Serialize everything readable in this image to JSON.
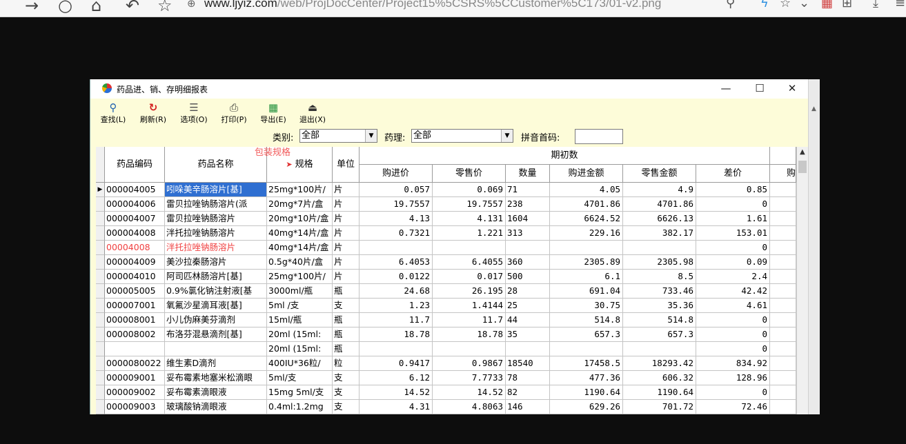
{
  "browser": {
    "url_host": "www.ljyiz.com",
    "url_path": "/web/ProjDocCenter/Project15%5CSRS%5CCustomer%5C173/01-v2.png"
  },
  "window": {
    "title": "药品进、销、存明细报表",
    "minimize": "—",
    "maximize": "☐",
    "close": "✕"
  },
  "toolbar": {
    "buttons": [
      {
        "label": "查找(L)",
        "icon": "search-icon",
        "glyph": "🔍"
      },
      {
        "label": "刷新(R)",
        "icon": "refresh-icon",
        "glyph": "↻"
      },
      {
        "label": "选项(O)",
        "icon": "options-icon",
        "glyph": "☰"
      },
      {
        "label": "打印(P)",
        "icon": "printer-icon",
        "glyph": "⎙"
      },
      {
        "label": "导出(E)",
        "icon": "excel-export-icon",
        "glyph": "▦"
      },
      {
        "label": "退出(X)",
        "icon": "exit-door-icon",
        "glyph": "⏏"
      }
    ]
  },
  "filters": {
    "category_label": "类别:",
    "category_value": "全部",
    "pharmacology_label": "药理:",
    "pharmacology_value": "全部",
    "pinyin_label": "拼音首码:",
    "pinyin_value": ""
  },
  "overlay_label": "包装规格",
  "grid": {
    "headers": {
      "code": "药品编码",
      "name": "药品名称",
      "spec": "规格",
      "unit": "单位",
      "group": "期初数",
      "purchase_price": "购进价",
      "retail_price": "零售价",
      "qty": "数量",
      "purchase_amount": "购进金额",
      "retail_amount": "零售金额",
      "diff": "差价",
      "next": "购"
    },
    "rows": [
      {
        "code": "000004005",
        "name": "吲哚美辛肠溶片[基]",
        "spec": "25mg*100片/",
        "unit": "片",
        "pp": "0.057",
        "rp": "0.069",
        "qty": "71",
        "pa": "4.05",
        "ra": "4.9",
        "diff": "0.85"
      },
      {
        "code": "000004006",
        "name": "雷贝拉唑钠肠溶片(派",
        "spec": "20mg*7片/盒",
        "unit": "片",
        "pp": "19.7557",
        "rp": "19.7557",
        "qty": "238",
        "pa": "4701.86",
        "ra": "4701.86",
        "diff": "0"
      },
      {
        "code": "000004007",
        "name": "雷贝拉唑钠肠溶片",
        "spec": "20mg*10片/盒",
        "unit": "片",
        "pp": "4.13",
        "rp": "4.131",
        "qty": "1604",
        "pa": "6624.52",
        "ra": "6626.13",
        "diff": "1.61"
      },
      {
        "code": "000004008",
        "name": "泮托拉唑钠肠溶片",
        "spec": "40mg*14片/盒",
        "unit": "片",
        "pp": "0.7321",
        "rp": "1.221",
        "qty": "313",
        "pa": "229.16",
        "ra": "382.17",
        "diff": "153.01"
      },
      {
        "code": "00004008",
        "name": "泮托拉唑钠肠溶片",
        "spec": "40mg*14片/盒",
        "unit": "片",
        "pp": "",
        "rp": "",
        "qty": "",
        "pa": "",
        "ra": "",
        "diff": "0",
        "red": true
      },
      {
        "code": "000004009",
        "name": "美沙拉秦肠溶片",
        "spec": "0.5g*40片/盒",
        "unit": "片",
        "pp": "6.4053",
        "rp": "6.4055",
        "qty": "360",
        "pa": "2305.89",
        "ra": "2305.98",
        "diff": "0.09"
      },
      {
        "code": "000004010",
        "name": "阿司匹林肠溶片[基]",
        "spec": "25mg*100片/",
        "unit": "片",
        "pp": "0.0122",
        "rp": "0.017",
        "qty": "500",
        "pa": "6.1",
        "ra": "8.5",
        "diff": "2.4"
      },
      {
        "code": "000005005",
        "name": "0.9%氯化钠注射液[基",
        "spec": "3000ml/瓶",
        "unit": "瓶",
        "pp": "24.68",
        "rp": "26.195",
        "qty": "28",
        "pa": "691.04",
        "ra": "733.46",
        "diff": "42.42"
      },
      {
        "code": "000007001",
        "name": "氧氟沙星滴耳液[基]",
        "spec": "5ml /支",
        "unit": "支",
        "pp": "1.23",
        "rp": "1.4144",
        "qty": "25",
        "pa": "30.75",
        "ra": "35.36",
        "diff": "4.61"
      },
      {
        "code": "000008001",
        "name": "小儿伪麻美芬滴剂",
        "spec": "15ml/瓶",
        "unit": "瓶",
        "pp": "11.7",
        "rp": "11.7",
        "qty": "44",
        "pa": "514.8",
        "ra": "514.8",
        "diff": "0"
      },
      {
        "code": "000008002",
        "name": "布洛芬混悬滴剂[基]",
        "spec": "20ml (15ml:",
        "unit": "瓶",
        "pp": "18.78",
        "rp": "18.78",
        "qty": "35",
        "pa": "657.3",
        "ra": "657.3",
        "diff": "0"
      },
      {
        "code": "",
        "name": "",
        "spec": "20ml (15ml:",
        "unit": "瓶",
        "pp": "",
        "rp": "",
        "qty": "",
        "pa": "",
        "ra": "",
        "diff": "0"
      },
      {
        "code": "0000080022",
        "name": "维生素D滴剂",
        "spec": "400IU*36粒/",
        "unit": "粒",
        "pp": "0.9417",
        "rp": "0.9867",
        "qty": "18540",
        "pa": "17458.5",
        "ra": "18293.42",
        "diff": "834.92"
      },
      {
        "code": "000009001",
        "name": "妥布霉素地塞米松滴眼",
        "spec": "5ml/支",
        "unit": "支",
        "pp": "6.12",
        "rp": "7.7733",
        "qty": "78",
        "pa": "477.36",
        "ra": "606.32",
        "diff": "128.96"
      },
      {
        "code": "000009002",
        "name": "妥布霉素滴眼液",
        "spec": "15mg 5ml/支",
        "unit": "支",
        "pp": "14.52",
        "rp": "14.52",
        "qty": "82",
        "pa": "1190.64",
        "ra": "1190.64",
        "diff": "0"
      },
      {
        "code": "000009003",
        "name": "玻璃酸钠滴眼液",
        "spec": "0.4ml:1.2mg",
        "unit": "支",
        "pp": "4.31",
        "rp": "4.8063",
        "qty": "146",
        "pa": "629.26",
        "ra": "701.72",
        "diff": "72.46"
      }
    ]
  }
}
